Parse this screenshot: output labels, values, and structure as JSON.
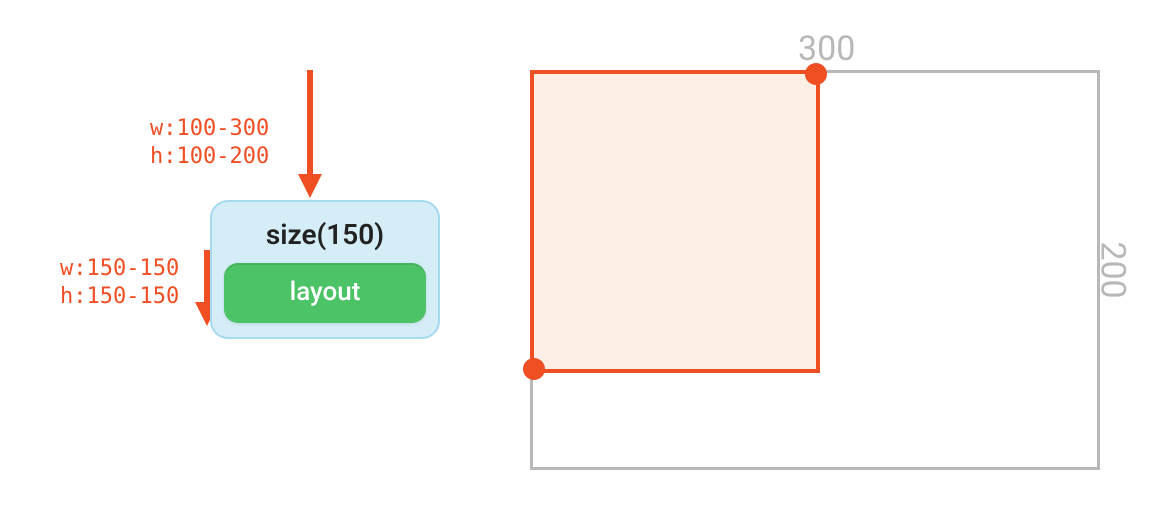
{
  "constraints": {
    "incoming": {
      "w": "w:100-300",
      "h": "h:100-200"
    },
    "outgoing": {
      "w": "w:150-150",
      "h": "h:150-150"
    }
  },
  "sizeBox": {
    "title": "size(150)",
    "child": "layout"
  },
  "rects": {
    "outer": {
      "wLabel": "300",
      "hLabel": "200"
    }
  }
}
